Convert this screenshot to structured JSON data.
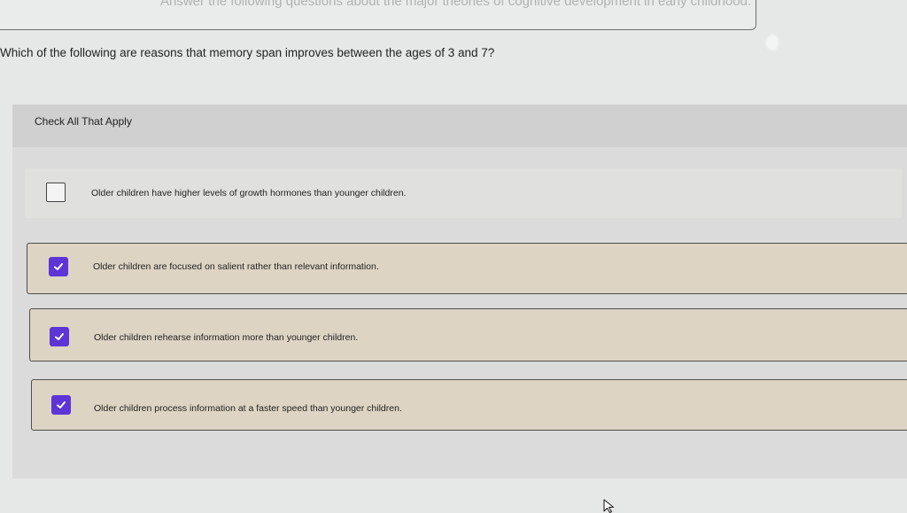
{
  "header": {
    "truncated_text": "Answer the following questions about the major theories of cognitive development in early childhood."
  },
  "question": {
    "text": "Which of the following are reasons that memory span improves between the ages of 3 and 7?"
  },
  "instructions": "Check All That Apply",
  "options": [
    {
      "label": "Older children have higher levels of growth hormones than younger children.",
      "checked": false
    },
    {
      "label": "Older children are focused on salient rather than relevant information.",
      "checked": true
    },
    {
      "label": "Older children rehearse information more than younger children.",
      "checked": true
    },
    {
      "label": "Older children process information at a faster speed than younger children.",
      "checked": true
    }
  ],
  "colors": {
    "checkbox_checked": "#5d34d6",
    "selected_option_bg": "#ddd4c4"
  },
  "icons": {
    "checkmark": "checkmark-icon",
    "cursor": "mouse-cursor-icon"
  }
}
